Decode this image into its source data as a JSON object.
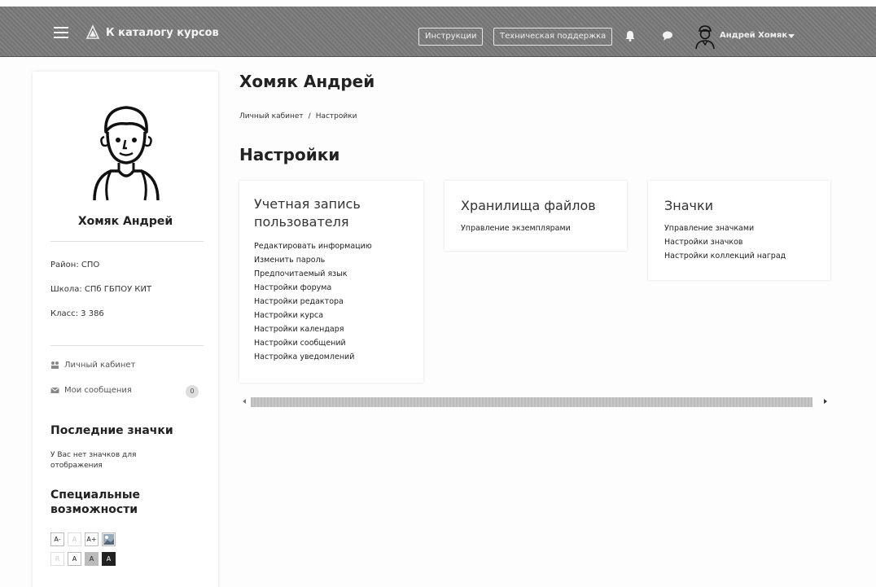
{
  "navbar": {
    "brand": "К каталогу курсов",
    "instructions": "Инструкции",
    "support": "Техническая поддержка",
    "user_name": "Андрей Хомяк"
  },
  "sidebar": {
    "name": "Хомяк Андрей",
    "district": "Район: СПО",
    "school": "Школа: СПб ГБПОУ КИТ",
    "class": "Класс: 3 386",
    "link_cabinet": "Личный кабинет",
    "link_messages": "Мои сообщения",
    "messages_count": "0",
    "badges_heading": "Последние значки",
    "badges_text": "У Вас нет значков для отображения",
    "accessibility_heading": "Специальные возможности",
    "acc_row1": [
      "A-",
      "A",
      "A+"
    ],
    "acc_row2": [
      "R",
      "A",
      "A",
      "A"
    ]
  },
  "main": {
    "title": "Хомяк Андрей",
    "breadcrumb": {
      "home": "Личный кабинет",
      "sep": "/",
      "current": "Настройки"
    },
    "heading": "Настройки",
    "cards": [
      {
        "title": "Учетная запись пользователя",
        "links": [
          "Редактировать информацию",
          "Изменить пароль",
          "Предпочитаемый язык",
          "Настройки форума",
          "Настройки редактора",
          "Настройки курса",
          "Настройки календаря",
          "Настройки сообщений",
          "Настройка уведомлений"
        ]
      },
      {
        "title": "Хранилища файлов",
        "links": [
          "Управление экземплярами"
        ]
      },
      {
        "title": "Значки",
        "links": [
          "Управление значками",
          "Настройки значков",
          "Настройки коллекций наград"
        ]
      }
    ]
  },
  "colors": {
    "navbar": "#7a7a7a",
    "card_bg": "#ffffff",
    "dark_btn": "#222222"
  }
}
